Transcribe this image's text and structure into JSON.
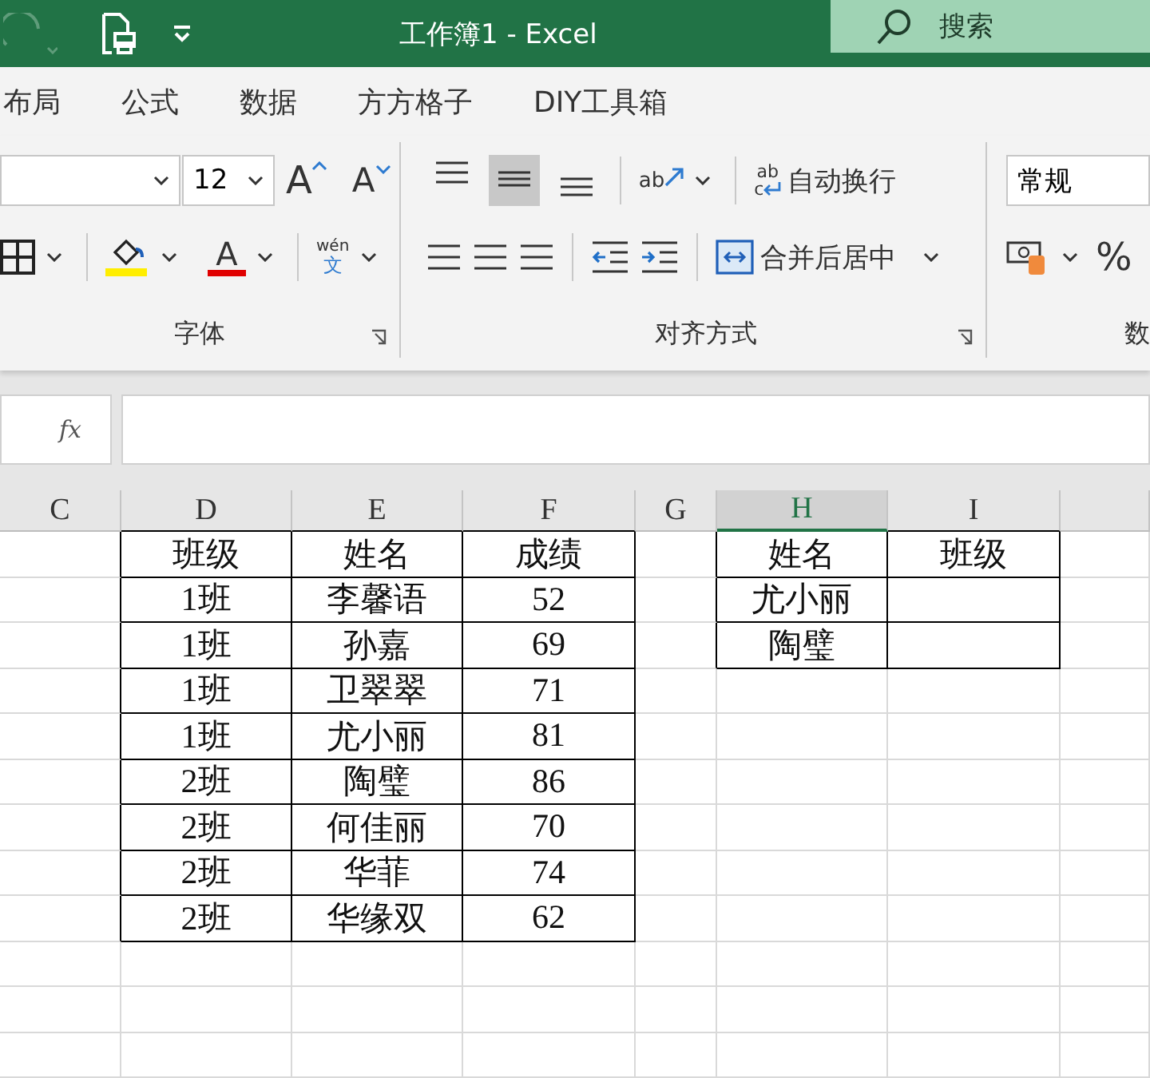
{
  "title_bar": {
    "title": "工作簿1  -  Excel",
    "search": {
      "placeholder": "搜索"
    }
  },
  "ribbon_tabs": [
    {
      "label": "布局"
    },
    {
      "label": "公式"
    },
    {
      "label": "数据"
    },
    {
      "label": "方方格子"
    },
    {
      "label": "DIY工具箱"
    }
  ],
  "font_group": {
    "font_size": "12",
    "grow_glyph": "A",
    "shrink_glyph": "A",
    "font_color_glyph": "A",
    "phonetic_top": "wén",
    "phonetic_bottom": "文",
    "label": "字体"
  },
  "alignment_group": {
    "vertical_align": [
      {
        "kind": "top",
        "selected": false
      },
      {
        "kind": "middle",
        "selected": true
      },
      {
        "kind": "bottom",
        "selected": false
      }
    ],
    "orientation_glyph": "ab",
    "wrap_glyph": "ab",
    "wrap_glyph_2": "c",
    "wrap_text": "自动换行",
    "merge_center": "合并后居中",
    "label": "对齐方式"
  },
  "number_group": {
    "format": "常规",
    "percent": "%",
    "label": "数"
  },
  "formula_bar": {
    "fx": "fx"
  },
  "sheet": {
    "columns": [
      {
        "label": "C",
        "selected": false
      },
      {
        "label": "D",
        "selected": false
      },
      {
        "label": "E",
        "selected": false
      },
      {
        "label": "F",
        "selected": false
      },
      {
        "label": "G",
        "selected": false
      },
      {
        "label": "H",
        "selected": true
      },
      {
        "label": "I",
        "selected": false
      }
    ],
    "tables": [
      {
        "rows": [
          [
            "班级",
            "姓名",
            "成绩"
          ],
          [
            "1班",
            "李馨语",
            "52"
          ],
          [
            "1班",
            "孙嘉",
            "69"
          ],
          [
            "1班",
            "卫翠翠",
            "71"
          ],
          [
            "1班",
            "尤小丽",
            "81"
          ],
          [
            "2班",
            "陶璧",
            "86"
          ],
          [
            "2班",
            "何佳丽",
            "70"
          ],
          [
            "2班",
            "华菲",
            "74"
          ],
          [
            "2班",
            "华缘双",
            "62"
          ]
        ]
      },
      {
        "rows": [
          [
            "姓名",
            "班级"
          ],
          [
            "尤小丽",
            null
          ],
          [
            "陶璧",
            null
          ]
        ]
      }
    ]
  }
}
